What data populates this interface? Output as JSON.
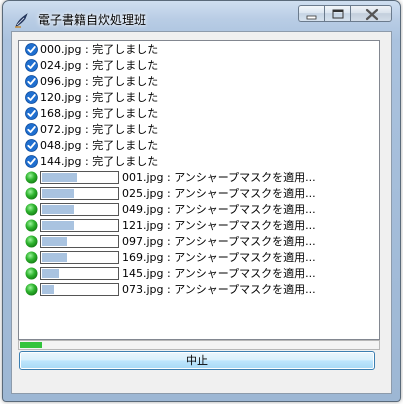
{
  "window": {
    "title": "電子書籍自炊処理班"
  },
  "completed": [
    {
      "file": "000.jpg",
      "sep": " : ",
      "status": "完了しました"
    },
    {
      "file": "024.jpg",
      "sep": " : ",
      "status": "完了しました"
    },
    {
      "file": "096.jpg",
      "sep": " : ",
      "status": "完了しました"
    },
    {
      "file": "120.jpg",
      "sep": " : ",
      "status": "完了しました"
    },
    {
      "file": "168.jpg",
      "sep": " : ",
      "status": "完了しました"
    },
    {
      "file": "072.jpg",
      "sep": " : ",
      "status": "完了しました"
    },
    {
      "file": "048.jpg",
      "sep": " : ",
      "status": "完了しました"
    },
    {
      "file": "144.jpg",
      "sep": " : ",
      "status": "完了しました"
    }
  ],
  "processing": [
    {
      "file": "001.jpg",
      "sep": " : ",
      "status": "アンシャープマスクを適用...",
      "progress": 0.45
    },
    {
      "file": "025.jpg",
      "sep": " : ",
      "status": "アンシャープマスクを適用...",
      "progress": 0.42
    },
    {
      "file": "049.jpg",
      "sep": " : ",
      "status": "アンシャープマスクを適用...",
      "progress": 0.42
    },
    {
      "file": "121.jpg",
      "sep": " : ",
      "status": "アンシャープマスクを適用...",
      "progress": 0.42
    },
    {
      "file": "097.jpg",
      "sep": " : ",
      "status": "アンシャープマスクを適用...",
      "progress": 0.33
    },
    {
      "file": "169.jpg",
      "sep": " : ",
      "status": "アンシャープマスクを適用...",
      "progress": 0.33
    },
    {
      "file": "145.jpg",
      "sep": " : ",
      "status": "アンシャープマスクを適用...",
      "progress": 0.22
    },
    {
      "file": "073.jpg",
      "sep": " : ",
      "status": "アンシャープマスクを適用...",
      "progress": 0.16
    }
  ],
  "overall_progress": 0.06,
  "buttons": {
    "stop": "中止"
  },
  "colors": {
    "done_icon": "#1f6fd0",
    "working_icon": "#2fb52f",
    "bar_fill": "#a9c3e0",
    "overall_fill": "#32c43c"
  },
  "icons": {
    "app": "quill-pen-icon",
    "done": "check-circle-icon",
    "working": "green-circle-icon"
  }
}
